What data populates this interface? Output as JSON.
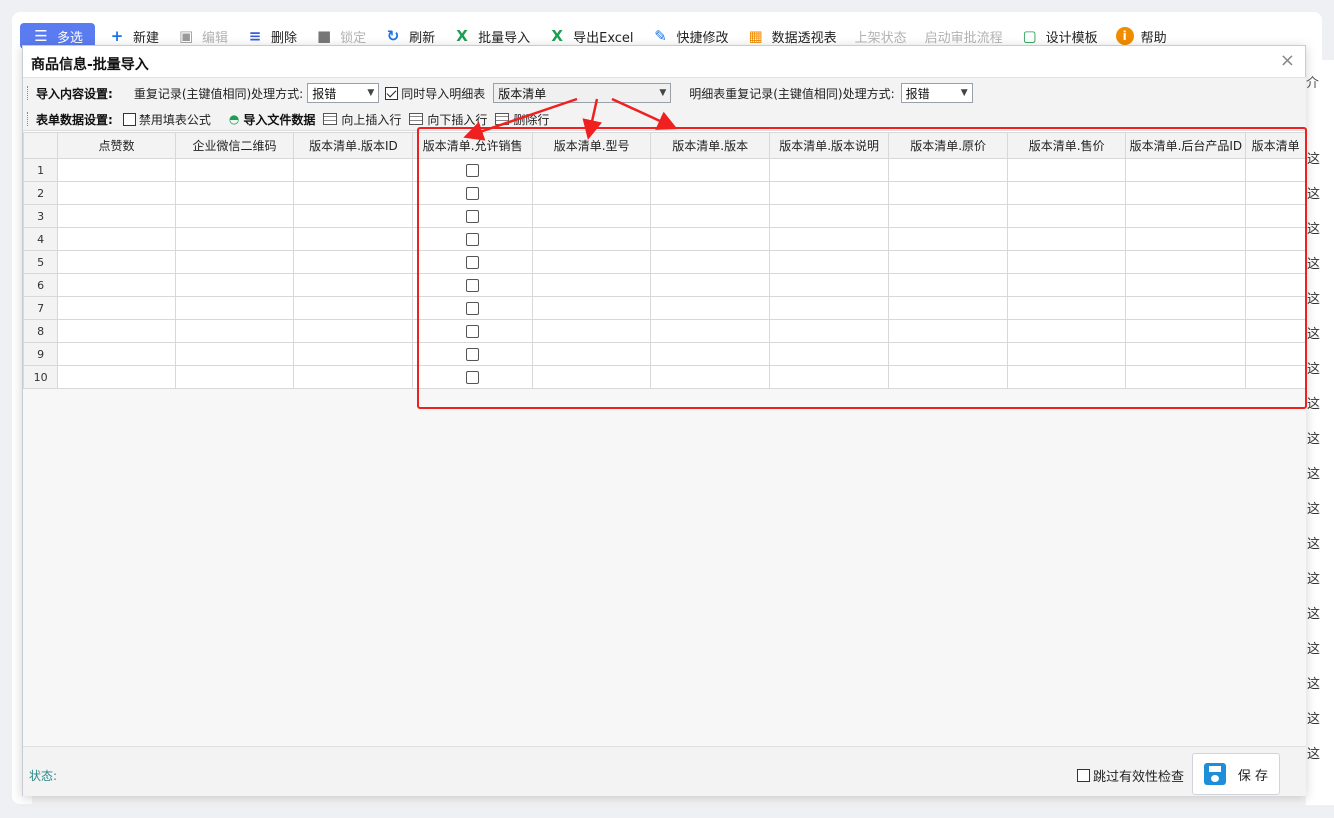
{
  "toolbar": {
    "items": [
      {
        "label": "多选",
        "icon": "list-icon",
        "state": "active",
        "color": "#5b7cf0"
      },
      {
        "label": "新建",
        "icon": "plus-icon",
        "state": "enabled",
        "color": "#1a73e8"
      },
      {
        "label": "编辑",
        "icon": "folder-edit-icon",
        "state": "disabled",
        "color": "#9a9a9a"
      },
      {
        "label": "删除",
        "icon": "delete-list-icon",
        "state": "enabled",
        "color": "#3b5bdb"
      },
      {
        "label": "锁定",
        "icon": "lock-icon",
        "state": "disabled",
        "color": "#777777"
      },
      {
        "label": "刷新",
        "icon": "refresh-icon",
        "state": "enabled",
        "color": "#1a73e8"
      },
      {
        "label": "批量导入",
        "icon": "excel-import-icon",
        "state": "enabled",
        "color": "#1e9e52"
      },
      {
        "label": "导出Excel",
        "icon": "excel-export-icon",
        "state": "enabled",
        "color": "#1e9e52"
      },
      {
        "label": "快捷修改",
        "icon": "pencil-icon",
        "state": "enabled",
        "color": "#1a73e8"
      },
      {
        "label": "数据透视表",
        "icon": "pivot-table-icon",
        "state": "enabled",
        "color": "#f08c00"
      },
      {
        "label": "上架状态",
        "icon": "",
        "state": "disabled",
        "color": ""
      },
      {
        "label": "启动审批流程",
        "icon": "",
        "state": "disabled",
        "color": ""
      },
      {
        "label": "设计模板",
        "icon": "design-template-icon",
        "state": "enabled",
        "color": "#1e9e52"
      },
      {
        "label": "帮助",
        "icon": "help-icon",
        "state": "enabled",
        "color": "#f08c00"
      }
    ]
  },
  "background": {
    "right_header": "介",
    "right_rows": [
      "这",
      "这",
      "这",
      "这",
      "这",
      "这",
      "这",
      "这",
      "这",
      "这",
      "这",
      "这",
      "这",
      "这",
      "这",
      "这",
      "这",
      "这"
    ]
  },
  "dialog": {
    "title": "商品信息-批量导入",
    "close_label": "×",
    "import_settings_label": "导入内容设置:",
    "duplicate_handling_label": "重复记录(主键值相同)处理方式:",
    "duplicate_handling_value": "报错",
    "import_detail_label": "同时导入明细表",
    "import_detail_checked": true,
    "detail_table_value": "版本清单",
    "detail_duplicate_label": "明细表重复记录(主键值相同)处理方式:",
    "detail_duplicate_value": "报错",
    "form_data_label": "表单数据设置:",
    "disable_formula_label": "禁用填表公式",
    "disable_formula_checked": false,
    "import_file_label": "导入文件数据",
    "insert_above_label": "向上插入行",
    "insert_below_label": "向下插入行",
    "delete_row_label": "删除行"
  },
  "grid": {
    "columns": [
      "点赞数",
      "企业微信二维码",
      "版本清单.版本ID",
      "版本清单.允许销售",
      "版本清单.型号",
      "版本清单.版本",
      "版本清单.版本说明",
      "版本清单.原价",
      "版本清单.售价",
      "版本清单.后台产品ID",
      "版本清单"
    ],
    "checkbox_column": 3,
    "rows": [
      1,
      2,
      3,
      4,
      5,
      6,
      7,
      8,
      9,
      10
    ]
  },
  "footer": {
    "status_label": "状态:",
    "skip_validation_label": "跳过有效性检查",
    "skip_validation_checked": false,
    "save_label": "保 存"
  },
  "colors": {
    "annotation_red": "#f02020",
    "status_teal": "#2a8a8a",
    "save_icon_blue": "#1c8fd8"
  }
}
